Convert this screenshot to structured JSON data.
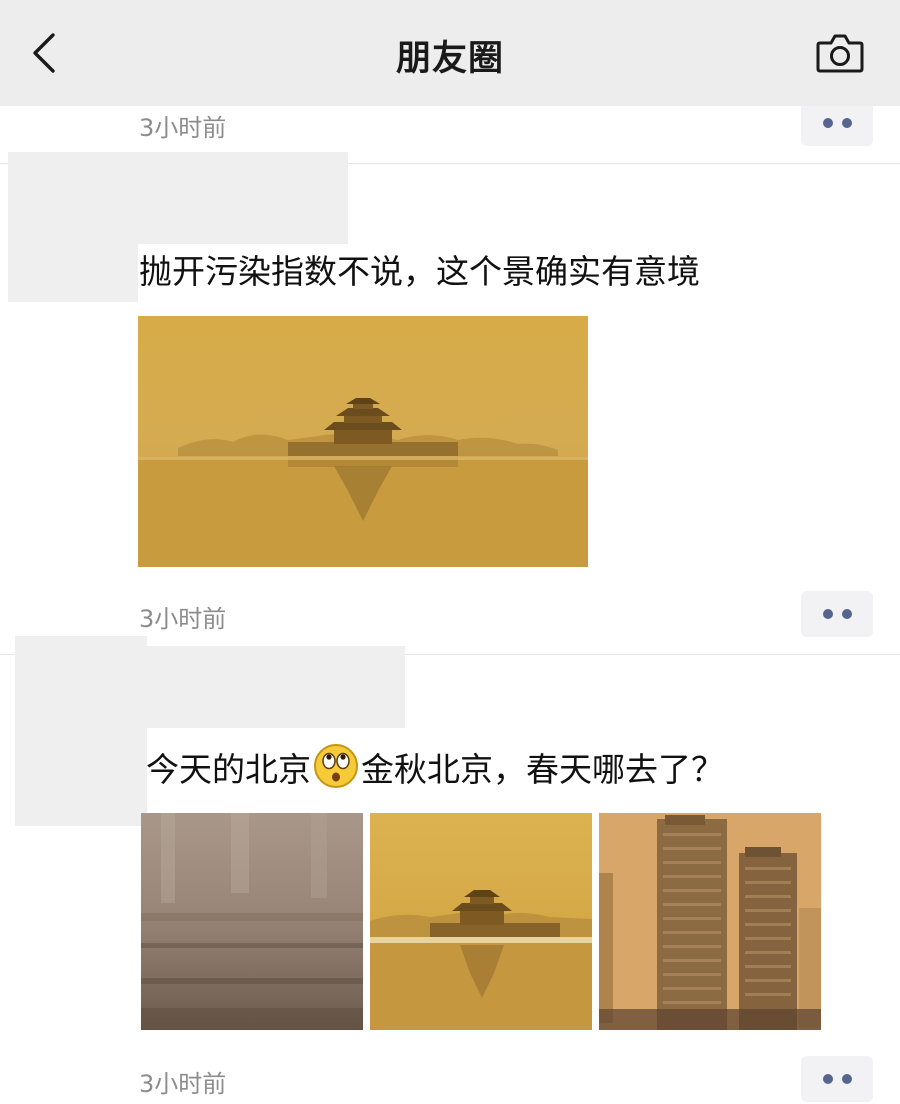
{
  "header": {
    "title": "朋友圈",
    "back_icon": "chevron-left-icon",
    "camera_icon": "camera-icon"
  },
  "top_partial": {
    "time": "3小时前"
  },
  "posts": [
    {
      "text": "抛开污染指数不说，这个景确实有意境",
      "time": "3小时前",
      "images": [
        "Forbidden City corner tower in sandstorm"
      ]
    },
    {
      "text_before_emoji": "今天的北京",
      "emoji": "rolling-eyes-emoji",
      "text_after_emoji": "金秋北京，春天哪去了？",
      "time": "3小时前",
      "images": [
        "hazy street",
        "Forbidden City corner tower",
        "high-rise buildings in sandstorm"
      ]
    }
  ],
  "colors": {
    "header_bg": "#ededed",
    "timestamp": "#8c8c8c",
    "more_dots": "#56658e",
    "sand": "#d1a442"
  }
}
